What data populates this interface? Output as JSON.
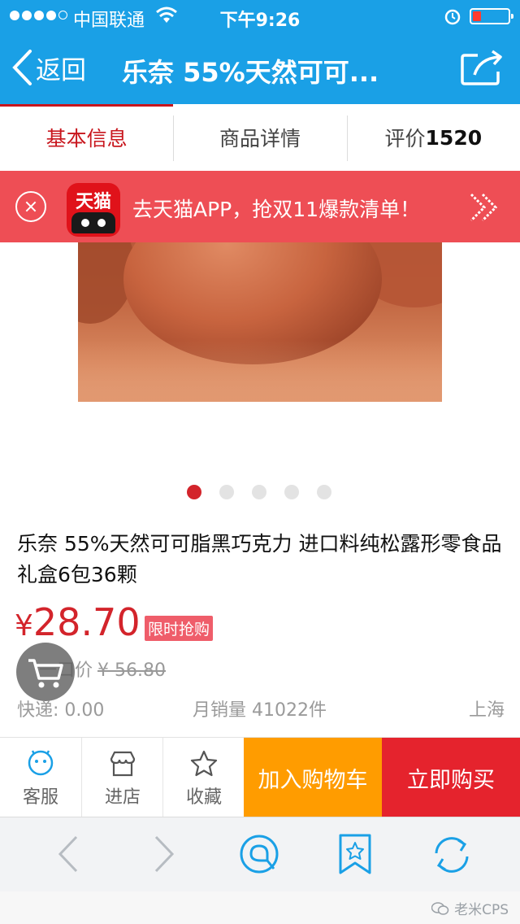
{
  "status_bar": {
    "carrier": "中国联通",
    "time": "下午9:26"
  },
  "nav": {
    "back_label": "返回",
    "title": "乐奈 55%天然可可..."
  },
  "tabs": [
    {
      "label": "基本信息"
    },
    {
      "label": "商品详情"
    },
    {
      "label": "评价",
      "count": "1520"
    }
  ],
  "banner": {
    "logo_text": "天猫",
    "text": "去天猫APP，抢双11爆款清单！"
  },
  "product": {
    "title": "乐奈 55%天然可可脂黑巧克力 进口料纯松露形零食品礼盒6包36颗",
    "price_symbol": "¥",
    "price": "28.70",
    "price_tag": "限时抢购",
    "orig_label": "一口价",
    "orig_price": "¥ 56.80",
    "shipping": "快递: 0.00",
    "sales": "月销量 41022件",
    "location": "上海",
    "image_count": 5,
    "active_image_index": 0
  },
  "actions": {
    "service": "客服",
    "store": "进店",
    "favorite": "收藏",
    "add_cart": "加入购物车",
    "buy_now": "立即购买"
  },
  "watermark": "老米CPS",
  "colors": {
    "header_blue": "#1aa0e6",
    "banner_red": "#ee4e55",
    "price_red": "#d3242b",
    "cart_orange": "#ff9c00",
    "buy_red": "#e5232d"
  }
}
